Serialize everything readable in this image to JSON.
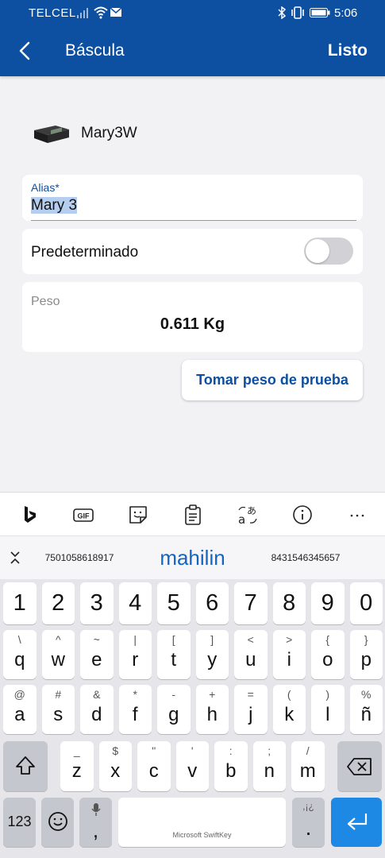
{
  "status_bar": {
    "carrier": "TELCEL",
    "time": "5:06"
  },
  "header": {
    "title": "Báscula",
    "done_label": "Listo"
  },
  "device": {
    "name": "Mary3W"
  },
  "alias": {
    "label": "Alias*",
    "value": "Mary 3"
  },
  "default_setting": {
    "label": "Predeterminado",
    "enabled": false
  },
  "weight": {
    "label": "Peso",
    "value": "0.611 Kg"
  },
  "test_button": {
    "label": "Tomar peso de prueba"
  },
  "keyboard": {
    "toolbar_icons": [
      "bing-icon",
      "gif-icon",
      "sticker-icon",
      "clipboard-icon",
      "translate-icon",
      "info-icon",
      "more-icon"
    ],
    "suggestions": [
      "7501058618917",
      "mahilin",
      "8431546345657"
    ],
    "number_row": [
      "1",
      "2",
      "3",
      "4",
      "5",
      "6",
      "7",
      "8",
      "9",
      "0"
    ],
    "row1": [
      {
        "main": "q",
        "alt": "\\"
      },
      {
        "main": "w",
        "alt": "^"
      },
      {
        "main": "e",
        "alt": "~"
      },
      {
        "main": "r",
        "alt": "|"
      },
      {
        "main": "t",
        "alt": "["
      },
      {
        "main": "y",
        "alt": "]"
      },
      {
        "main": "u",
        "alt": "<"
      },
      {
        "main": "i",
        "alt": ">"
      },
      {
        "main": "o",
        "alt": "{"
      },
      {
        "main": "p",
        "alt": "}"
      }
    ],
    "row2": [
      {
        "main": "a",
        "alt": "@"
      },
      {
        "main": "s",
        "alt": "#"
      },
      {
        "main": "d",
        "alt": "&"
      },
      {
        "main": "f",
        "alt": "*"
      },
      {
        "main": "g",
        "alt": "-"
      },
      {
        "main": "h",
        "alt": "+"
      },
      {
        "main": "j",
        "alt": "="
      },
      {
        "main": "k",
        "alt": "("
      },
      {
        "main": "l",
        "alt": ")"
      },
      {
        "main": "ñ",
        "alt": "%"
      }
    ],
    "row3": [
      {
        "main": "z",
        "alt": "_"
      },
      {
        "main": "x",
        "alt": "$"
      },
      {
        "main": "c",
        "alt": "\""
      },
      {
        "main": "v",
        "alt": "'"
      },
      {
        "main": "b",
        "alt": ":"
      },
      {
        "main": "n",
        "alt": ";"
      },
      {
        "main": "m",
        "alt": "/"
      }
    ],
    "numbers_key": "123",
    "comma": ",",
    "period": ".",
    "period_alt": ",¡¿",
    "space_label": "Microsoft SwiftKey"
  },
  "colors": {
    "brand_blue": "#0d4fa1",
    "enter_key": "#1e88e5",
    "suggestion_blue": "#1565c0"
  }
}
